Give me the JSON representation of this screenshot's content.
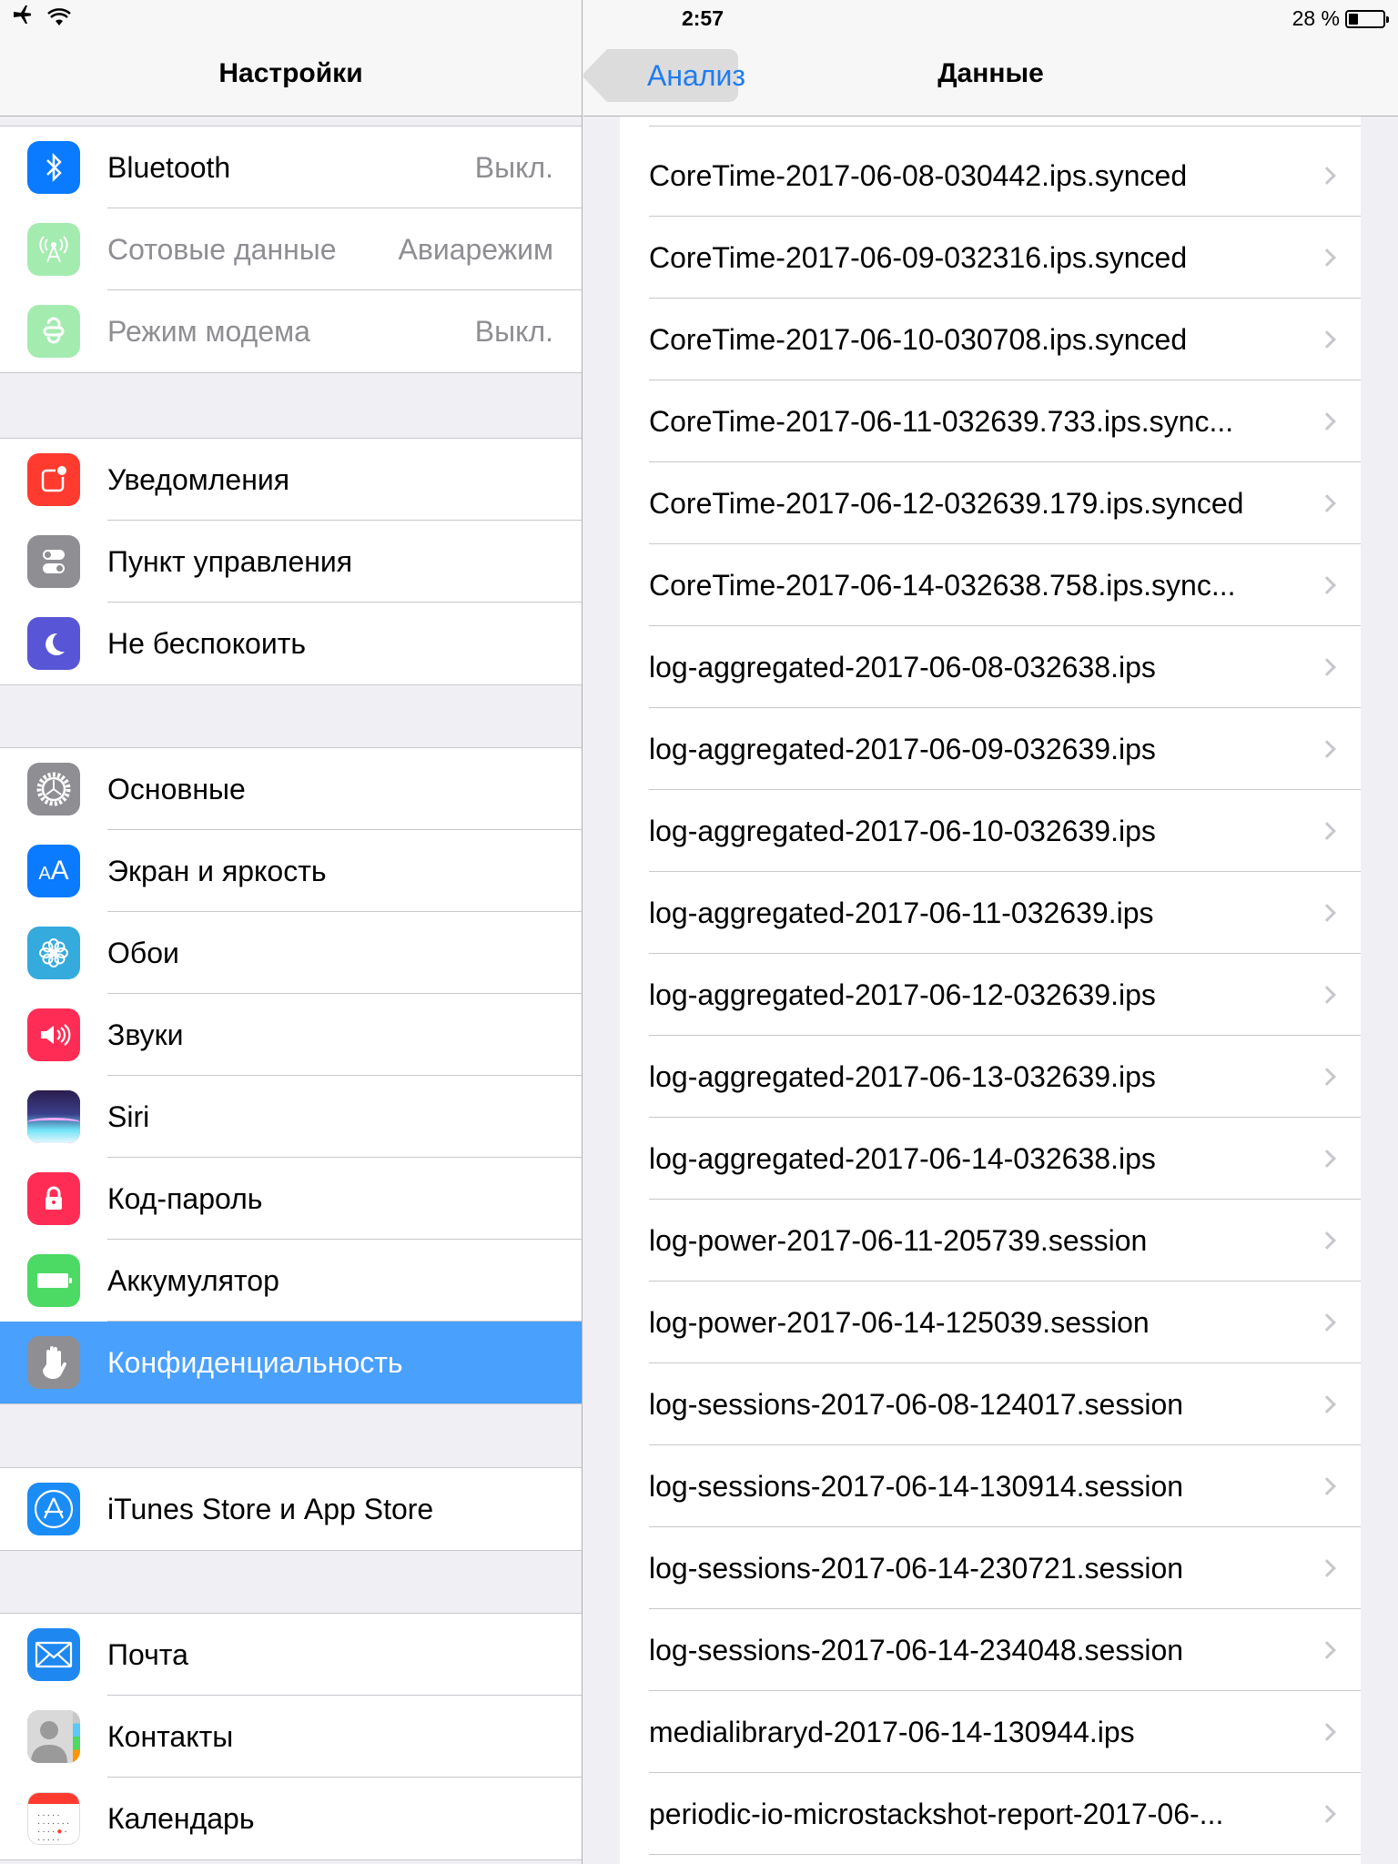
{
  "status_bar": {
    "time": "2:57",
    "battery_text": "28 %",
    "battery_level": 0.28
  },
  "master": {
    "title": "Настройки",
    "groups": [
      [
        {
          "icon": "bluetooth-icon",
          "color": "#0a7aff",
          "label": "Bluetooth",
          "value": "Выкл.",
          "dim": false
        },
        {
          "icon": "cellular-icon",
          "color": "#4cd964",
          "label": "Сотовые данные",
          "value": "Авиарежим",
          "dim": true
        },
        {
          "icon": "hotspot-icon",
          "color": "#4cd964",
          "label": "Режим модема",
          "value": "Выкл.",
          "dim": true
        }
      ],
      [
        {
          "icon": "notifications-icon",
          "color": "#ff3b30",
          "label": "Уведомления"
        },
        {
          "icon": "control-center-icon",
          "color": "#8e8e93",
          "label": "Пункт управления"
        },
        {
          "icon": "moon-icon",
          "color": "#5856d6",
          "label": "Не беспокоить"
        }
      ],
      [
        {
          "icon": "gear-icon",
          "color": "#8e8e93",
          "label": "Основные"
        },
        {
          "icon": "display-brightness-icon",
          "color": "#0a7aff",
          "label": "Экран и яркость"
        },
        {
          "icon": "wallpaper-icon",
          "color": "#35aadc",
          "label": "Обои"
        },
        {
          "icon": "sounds-icon",
          "color": "#ff2d55",
          "label": "Звуки"
        },
        {
          "icon": "siri-icon",
          "color": "#2b2d6e",
          "label": "Siri"
        },
        {
          "icon": "lock-icon",
          "color": "#ff2d55",
          "label": "Код-пароль"
        },
        {
          "icon": "battery-icon",
          "color": "#4cd964",
          "label": "Аккумулятор"
        },
        {
          "icon": "hand-icon",
          "color": "#8e8e93",
          "label": "Конфиденциальность",
          "selected": true
        }
      ],
      [
        {
          "icon": "app-store-icon",
          "color": "#1a8cf5",
          "label": "iTunes Store и App Store"
        }
      ],
      [
        {
          "icon": "mail-icon",
          "color": "#1e88f0",
          "label": "Почта"
        },
        {
          "icon": "contacts-icon",
          "color": "#9a9a9a",
          "label": "Контакты"
        },
        {
          "icon": "calendar-icon",
          "color": "#ffffff",
          "label": "Календарь"
        }
      ]
    ]
  },
  "detail": {
    "back_label": "Анализ",
    "title": "Данные",
    "files": [
      "CoreTime-2017-06-08-030442.ips.synced",
      "CoreTime-2017-06-09-032316.ips.synced",
      "CoreTime-2017-06-10-030708.ips.synced",
      "CoreTime-2017-06-11-032639.733.ips.sync...",
      "CoreTime-2017-06-12-032639.179.ips.synced",
      "CoreTime-2017-06-14-032638.758.ips.sync...",
      "log-aggregated-2017-06-08-032638.ips",
      "log-aggregated-2017-06-09-032639.ips",
      "log-aggregated-2017-06-10-032639.ips",
      "log-aggregated-2017-06-11-032639.ips",
      "log-aggregated-2017-06-12-032639.ips",
      "log-aggregated-2017-06-13-032639.ips",
      "log-aggregated-2017-06-14-032638.ips",
      "log-power-2017-06-11-205739.session",
      "log-power-2017-06-14-125039.session",
      "log-sessions-2017-06-08-124017.session",
      "log-sessions-2017-06-14-130914.session",
      "log-sessions-2017-06-14-230721.session",
      "log-sessions-2017-06-14-234048.session",
      "medialibraryd-2017-06-14-130944.ips",
      "periodic-io-microstackshot-report-2017-06-..."
    ]
  }
}
